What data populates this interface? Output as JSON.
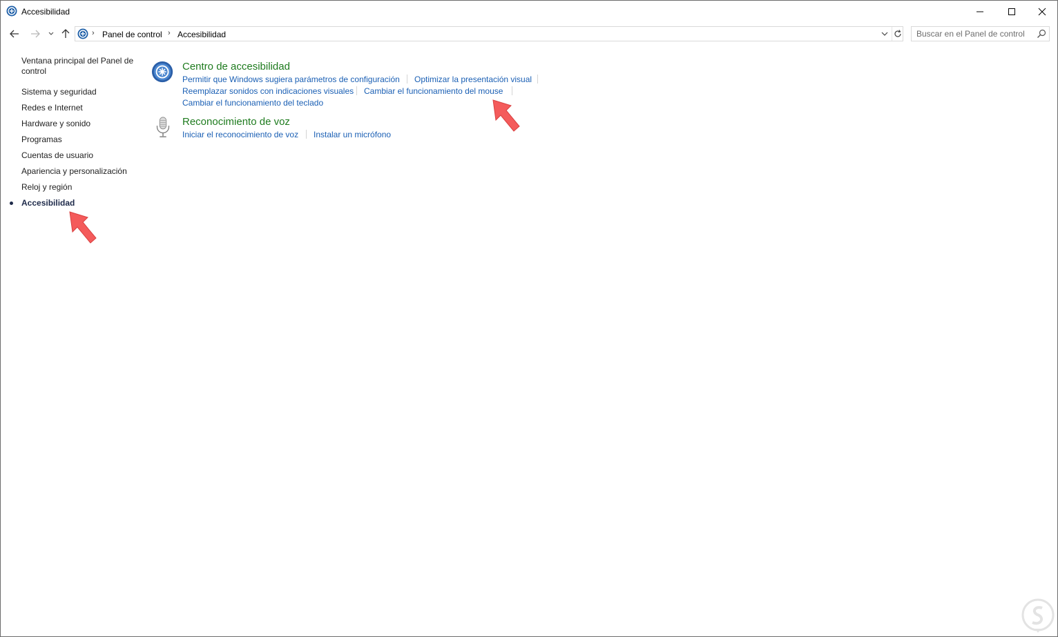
{
  "window": {
    "title": "Accesibilidad",
    "controls": [
      "minimize-icon",
      "maximize-icon",
      "close-icon"
    ]
  },
  "address": {
    "breadcrumb": [
      "Panel de control",
      "Accesibilidad"
    ],
    "search_placeholder": "Buscar en el Panel de control"
  },
  "sidebar": {
    "items": [
      {
        "label": "Ventana principal del Panel de control"
      },
      {
        "label": "Sistema y seguridad"
      },
      {
        "label": "Redes e Internet"
      },
      {
        "label": "Hardware y sonido"
      },
      {
        "label": "Programas"
      },
      {
        "label": "Cuentas de usuario"
      },
      {
        "label": "Apariencia y personalización"
      },
      {
        "label": "Reloj y región"
      },
      {
        "label": "Accesibilidad",
        "current": true
      }
    ]
  },
  "main": {
    "sections": [
      {
        "title": "Centro de accesibilidad",
        "icon": "ease-of-access-icon",
        "links": [
          "Permitir que Windows sugiera parámetros de configuración",
          "Optimizar la presentación visual",
          "Reemplazar sonidos con indicaciones visuales",
          "Cambiar el funcionamiento del mouse",
          "Cambiar el funcionamiento del teclado"
        ]
      },
      {
        "title": "Reconocimiento de voz",
        "icon": "microphone-icon",
        "links": [
          "Iniciar el reconocimiento de voz",
          "Instalar un micrófono"
        ]
      }
    ]
  },
  "colors": {
    "section_title": "#1e7b1e",
    "link": "#1a5fb4",
    "annotation_arrow": "#f45b5b"
  }
}
